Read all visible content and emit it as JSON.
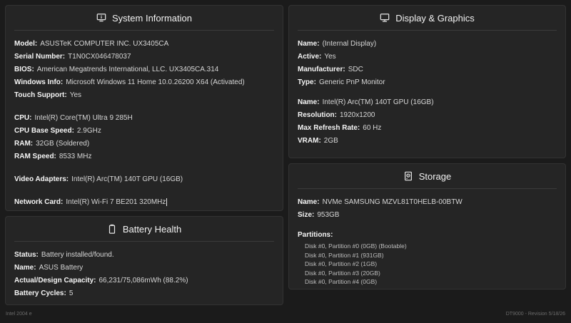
{
  "system": {
    "title": "System Information",
    "icon": "monitor-info-icon",
    "rows": [
      {
        "k": "Model:",
        "v": "ASUSTeK COMPUTER INC. UX3405CA"
      },
      {
        "k": "Serial Number:",
        "v": "T1N0CX046478037"
      },
      {
        "k": "BIOS:",
        "v": "American Megatrends International, LLC. UX3405CA.314"
      },
      {
        "k": "Windows Info:",
        "v": "Microsoft Windows 11 Home 10.0.26200 X64 (Activated)"
      },
      {
        "k": "Touch Support:",
        "v": "Yes"
      },
      {
        "k": "CPU:",
        "v": "Intel(R) Core(TM) Ultra 9 285H"
      },
      {
        "k": "CPU Base Speed:",
        "v": "2.9GHz"
      },
      {
        "k": "RAM:",
        "v": "32GB (Soldered)"
      },
      {
        "k": "RAM Speed:",
        "v": "8533 MHz"
      },
      {
        "k": "Video Adapters:",
        "v": "Intel(R) Arc(TM) 140T GPU (16GB)"
      },
      {
        "k": "Network Card:",
        "v": "Intel(R) Wi-Fi 7 BE201 320MHz"
      }
    ]
  },
  "battery": {
    "title": "Battery Health",
    "icon": "battery-icon",
    "rows": [
      {
        "k": "Status:",
        "v": "Battery installed/found."
      },
      {
        "k": "Name:",
        "v": "ASUS Battery"
      },
      {
        "k": "Actual/Design Capacity:",
        "v": "66,231/75,086mWh (88.2%)"
      },
      {
        "k": "Battery Cycles:",
        "v": "5"
      }
    ]
  },
  "display": {
    "title": "Display & Graphics",
    "icon": "monitor-icon",
    "rows": [
      {
        "k": "Name:",
        "v": "(Internal Display)"
      },
      {
        "k": "Active:",
        "v": "Yes"
      },
      {
        "k": "Manufacturer:",
        "v": "SDC"
      },
      {
        "k": "Type:",
        "v": "Generic PnP Monitor"
      },
      {
        "k": "Name:",
        "v": "Intel(R) Arc(TM) 140T GPU (16GB)"
      },
      {
        "k": "Resolution:",
        "v": "1920x1200"
      },
      {
        "k": "Max Refresh Rate:",
        "v": "60 Hz"
      },
      {
        "k": "VRAM:",
        "v": "2GB"
      }
    ]
  },
  "storage": {
    "title": "Storage",
    "icon": "drive-icon",
    "rows": [
      {
        "k": "Name:",
        "v": "NVMe SAMSUNG MZVL81T0HELB-00BTW"
      },
      {
        "k": "Size:",
        "v": "953GB"
      }
    ],
    "partitions_label": "Partitions:",
    "partitions": [
      "Disk #0, Partition #0 (0GB) (Bootable)",
      "Disk #0, Partition #1 (931GB)",
      "Disk #0, Partition #2 (1GB)",
      "Disk #0, Partition #3 (20GB)",
      "Disk #0, Partition #4 (0GB)"
    ]
  },
  "footer": {
    "left": "Intel 2004 e",
    "right": "DT9000 - Revision 5/18/26"
  }
}
